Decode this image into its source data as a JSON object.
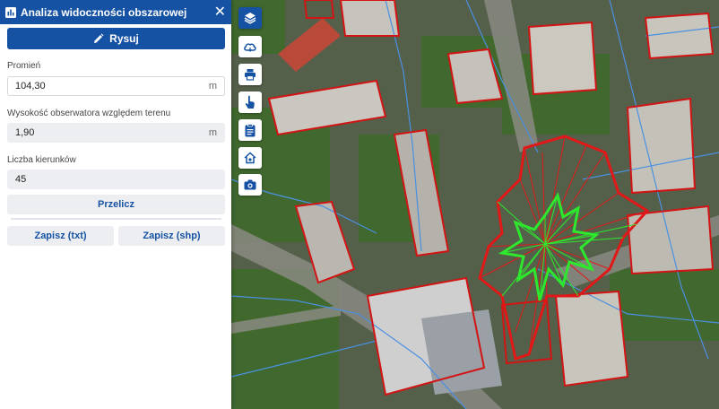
{
  "panel": {
    "title": "Analiza widoczności obszarowej",
    "draw_label": "Rysuj",
    "radius_label": "Promień",
    "radius_value": "104,30",
    "radius_unit": "m",
    "height_label": "Wysokość obserwatora względem terenu",
    "height_value": "1,90",
    "height_unit": "m",
    "directions_label": "Liczba kierunków",
    "directions_value": "45",
    "recalc_label": "Przelicz",
    "save_txt_label": "Zapisz (txt)",
    "save_shp_label": "Zapisz (shp)"
  },
  "toolbar": {
    "tools": [
      {
        "icon": "layers-icon",
        "active": true
      },
      {
        "icon": "cloud-icon",
        "active": false
      },
      {
        "icon": "print-icon",
        "active": false
      },
      {
        "icon": "hand-pointer-icon",
        "active": false
      },
      {
        "icon": "clipboard-icon",
        "active": false
      },
      {
        "icon": "home-icon",
        "active": false
      },
      {
        "icon": "camera-icon",
        "active": false
      }
    ]
  },
  "colors": {
    "accent": "#1652a3",
    "parcel_outline": "#d21414",
    "viewshed": "#2ee82e",
    "boundary": "#4a90e2"
  }
}
